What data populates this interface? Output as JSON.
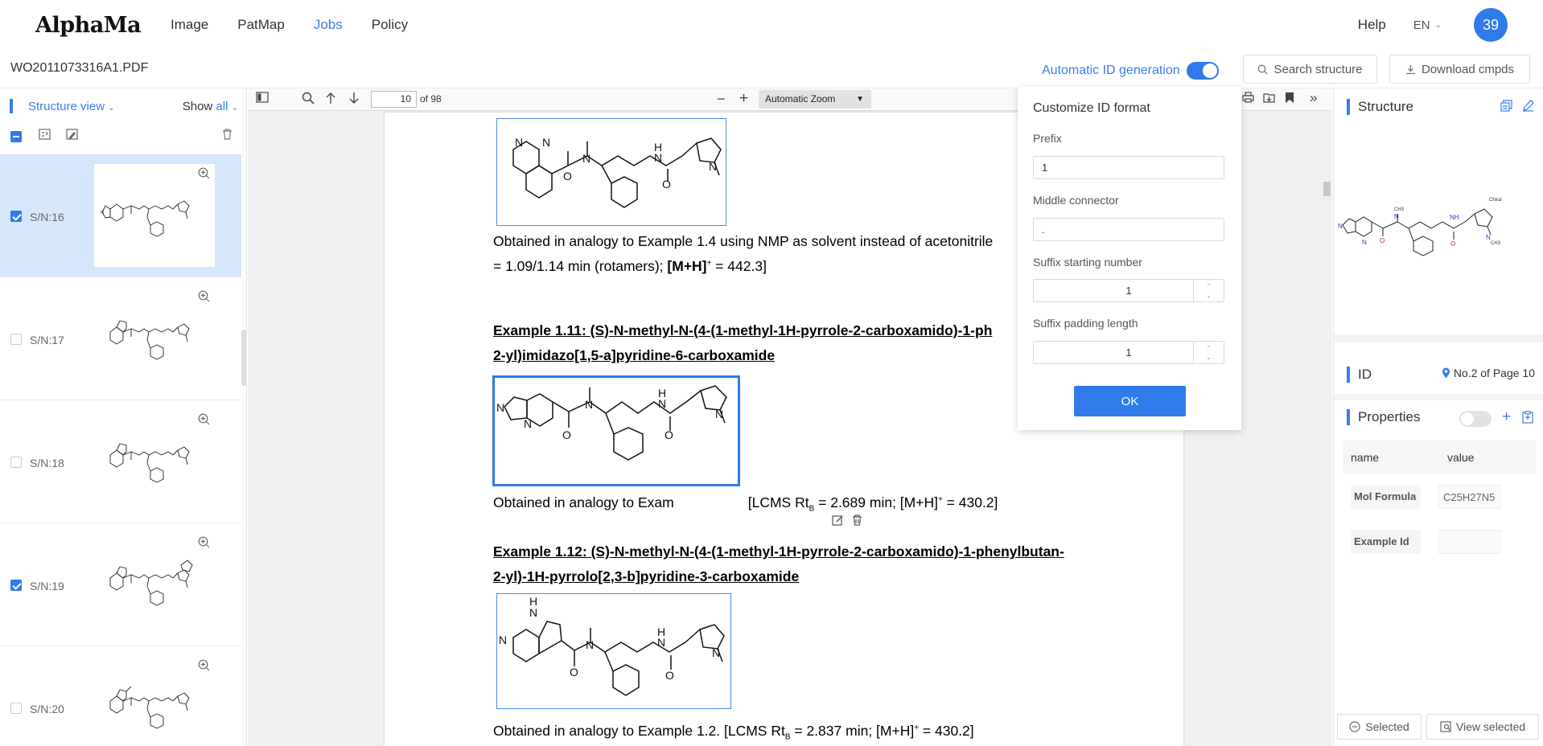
{
  "app": {
    "logo": "AlphaMa"
  },
  "nav": {
    "items": [
      "Image",
      "PatMap",
      "Jobs",
      "Policy"
    ],
    "active": "Jobs",
    "help": "Help",
    "lang": "EN",
    "avatar": "39"
  },
  "file": {
    "name": "WO2011073316A1.PDF"
  },
  "toolbar": {
    "auto_id_label": "Automatic ID generation",
    "auto_id_on": true,
    "search_label": "Search structure",
    "download_label": "Download cmpds"
  },
  "left": {
    "view_label": "Structure view",
    "show_label": "Show",
    "show_value": "all",
    "items": [
      {
        "sn": "S/N:16",
        "checked": true,
        "selected": true
      },
      {
        "sn": "S/N:17",
        "checked": false,
        "selected": false
      },
      {
        "sn": "S/N:18",
        "checked": false,
        "selected": false
      },
      {
        "sn": "S/N:19",
        "checked": true,
        "selected": false
      },
      {
        "sn": "S/N:20",
        "checked": false,
        "selected": false
      }
    ]
  },
  "pdf": {
    "page": "10",
    "of": "of 98",
    "zoom": "Automatic Zoom",
    "lines": {
      "l1": "Obtained in analogy to Example 1.4 using NMP as solvent instead of acetonitrile",
      "l2a": "= 1.09/1.14 min (rotamers); ",
      "l2b": "[M+H]",
      "l2c": "+",
      "l2d": " = 442.3]",
      "h1a": "Example 1.11: (S)-N-methyl-N-(4-(1-methyl-1H-pyrrole-2-carboxamido)-1-ph",
      "h1b": "2-yl)imidazo[1,5-a]pyridine-6-carboxamide",
      "l3a": "Obtained in analogy to Exam",
      "l3b": "[LCMS Rt",
      "l3c": "B",
      "l3d": " = 2.689 min; [M+H]",
      "l3e": "+",
      "l3f": " = 430.2]",
      "h2a": "Example 1.12: (S)-N-methyl-N-(4-(1-methyl-1H-pyrrole-2-carboxamido)-1-phenylbutan-",
      "h2b": "2-yl)-1H-pyrrolo[2,3-b]pyridine-3-carboxamide",
      "l4a": "Obtained in analogy to Example 1.2. [LCMS Rt",
      "l4b": "B",
      "l4c": " = 2.837 min; [M+H]",
      "l4d": "+",
      "l4e": " = 430.2]"
    }
  },
  "popup": {
    "title": "Customize ID format",
    "prefix_label": "Prefix",
    "prefix_value": "1",
    "middle_label": "Middle connector",
    "middle_value": ".",
    "suffix_start_label": "Suffix starting number",
    "suffix_start_value": "1",
    "suffix_pad_label": "Suffix padding length",
    "suffix_pad_value": "1",
    "ok_label": "OK"
  },
  "right": {
    "structure_title": "Structure",
    "chiral_label": "Chiral",
    "id_title": "ID",
    "id_location": "No.2 of Page 10",
    "properties_title": "Properties",
    "columns": [
      "name",
      "value"
    ],
    "props": [
      {
        "name": "Mol Formula",
        "value": "C25H27N5"
      },
      {
        "name": "Example Id",
        "value": ""
      }
    ],
    "selected_label": "Selected",
    "view_selected_label": "View selected"
  }
}
